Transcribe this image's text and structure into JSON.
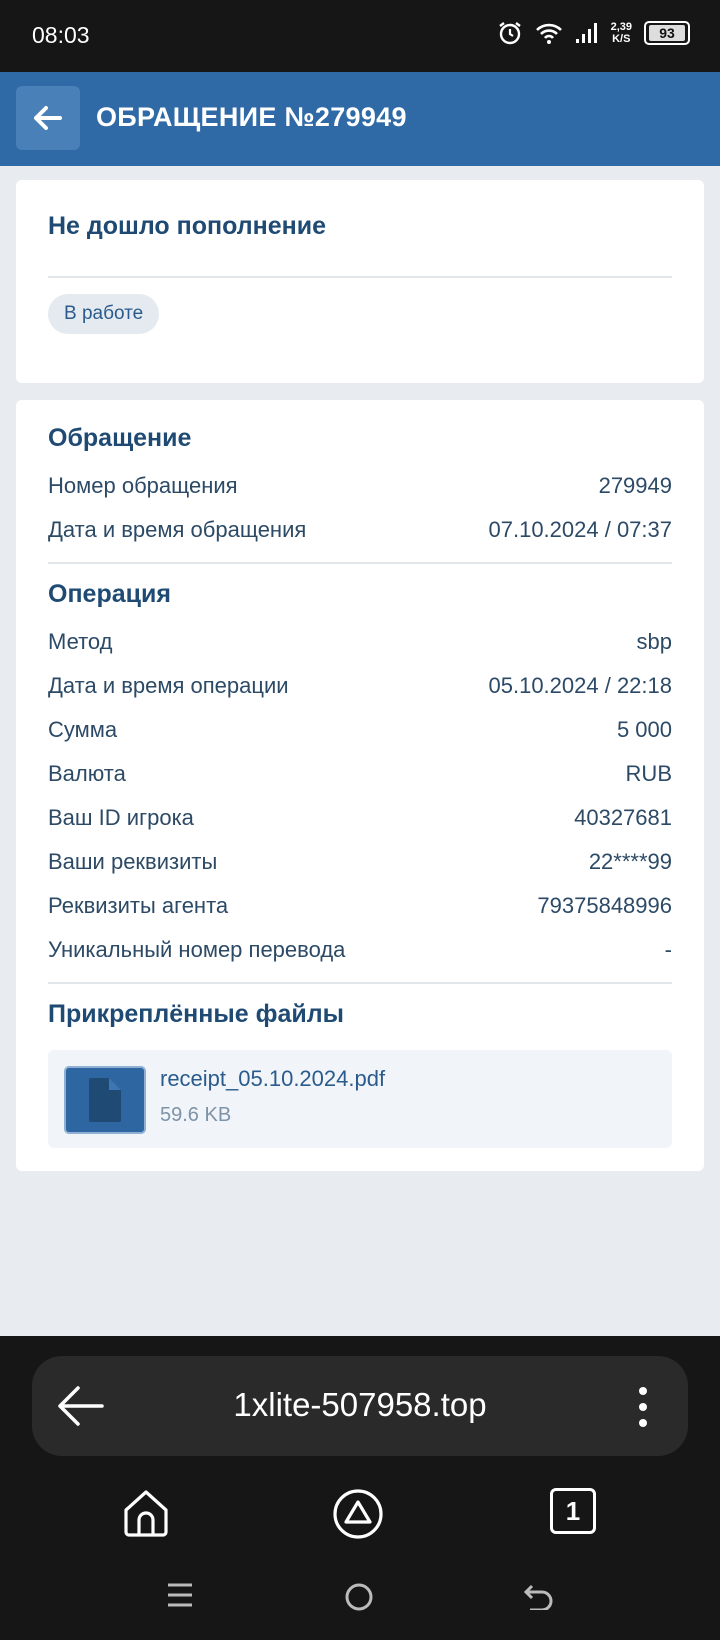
{
  "status_bar": {
    "time": "08:03",
    "net_speed_value": "2,39",
    "net_speed_unit": "K/S",
    "battery": "93"
  },
  "header": {
    "title": "ОБРАЩЕНИЕ №279949"
  },
  "issue": {
    "title": "Не дошло пополнение",
    "status": "В работе"
  },
  "appeal": {
    "section_title": "Обращение",
    "rows": [
      {
        "label": "Номер обращения",
        "value": "279949"
      },
      {
        "label": "Дата и время обращения",
        "value": "07.10.2024 / 07:37"
      }
    ]
  },
  "operation": {
    "section_title": "Операция",
    "rows": [
      {
        "label": "Метод",
        "value": "sbp"
      },
      {
        "label": "Дата и время операции",
        "value": "05.10.2024 / 22:18"
      },
      {
        "label": "Сумма",
        "value": "5 000"
      },
      {
        "label": "Валюта",
        "value": "RUB"
      },
      {
        "label": "Ваш ID игрока",
        "value": "40327681"
      },
      {
        "label": "Ваши реквизиты",
        "value": "22****99"
      },
      {
        "label": "Реквизиты агента",
        "value": "79375848996"
      },
      {
        "label": "Уникальный номер перевода",
        "value": "-"
      }
    ]
  },
  "attachments": {
    "section_title": "Прикреплённые файлы",
    "files": [
      {
        "name": "receipt_05.10.2024.pdf",
        "size": "59.6 KB"
      }
    ]
  },
  "browser": {
    "url": "1xlite-507958.top",
    "tab_count": "1"
  },
  "colors": {
    "header_bg": "#2f6aa6",
    "title_text": "#1f4a73",
    "status_chip_bg": "#e4eaf0"
  }
}
